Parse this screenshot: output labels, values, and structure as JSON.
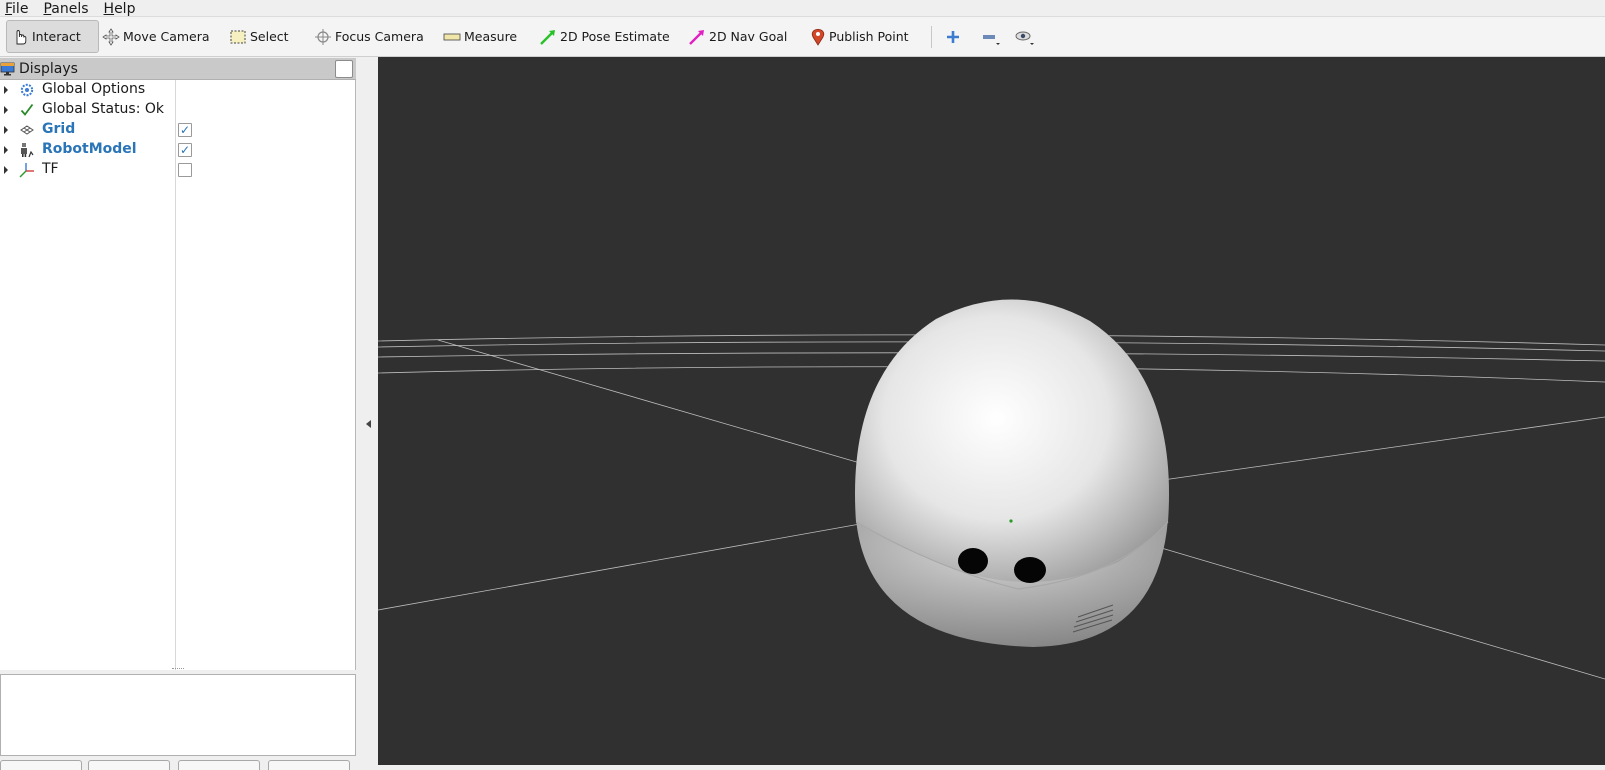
{
  "menu": {
    "items": [
      {
        "mnemonic": "F",
        "rest": "ile"
      },
      {
        "mnemonic": "P",
        "rest": "anels"
      },
      {
        "mnemonic": "H",
        "rest": "elp"
      }
    ]
  },
  "toolbar": {
    "interact": "Interact",
    "move_camera": "Move Camera",
    "select": "Select",
    "focus_camera": "Focus Camera",
    "measure": "Measure",
    "pose_estimate": "2D Pose Estimate",
    "nav_goal": "2D Nav Goal",
    "publish_point": "Publish Point"
  },
  "displays": {
    "title": "Displays",
    "items": [
      {
        "label": "Global Options",
        "icon": "gear-icon",
        "checkbox": null
      },
      {
        "label": "Global Status: Ok",
        "icon": "checkmark-icon",
        "checkbox": null
      },
      {
        "label": "Grid",
        "icon": "grid-icon",
        "checkbox": true
      },
      {
        "label": "RobotModel",
        "icon": "robot-icon",
        "checkbox": true
      },
      {
        "label": "TF",
        "icon": "axes-icon",
        "checkbox": false
      }
    ]
  },
  "colors": {
    "viewport_bg": "#303030",
    "highlight_text": "#2a74b8",
    "status_ok": "#2a8a2a"
  }
}
